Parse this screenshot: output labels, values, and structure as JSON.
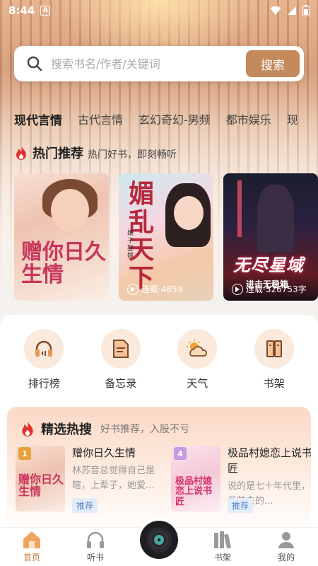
{
  "status_bar": {
    "time": "8:44",
    "notif_letter": "A"
  },
  "search": {
    "placeholder": "搜索书名/作者/关键词",
    "button_label": "搜索"
  },
  "categories": [
    "现代言情",
    "古代言情",
    "玄幻奇幻-男频",
    "都市娱乐",
    "现"
  ],
  "hot": {
    "title": "热门推荐",
    "subtitle": "热门好书，即刻畅听",
    "books": [
      {
        "cover_title": "赠你日久生情",
        "badge": ""
      },
      {
        "cover_title": "媚乱天下",
        "cover_sub": "娘子娶嫁",
        "badge": "连载·4859"
      },
      {
        "cover_title": "无尽星域",
        "cover_sub": "进击无稳箱",
        "badge": "连载·526753字"
      }
    ]
  },
  "shortcuts": [
    {
      "label": "排行榜",
      "icon": "headphones-icon"
    },
    {
      "label": "备忘录",
      "icon": "memo-icon"
    },
    {
      "label": "天气",
      "icon": "weather-icon"
    },
    {
      "label": "书架",
      "icon": "bookshelf-icon"
    }
  ],
  "featured": {
    "title": "精选热搜",
    "subtitle": "好书推荐，入股不亏",
    "items": [
      {
        "rank": "1",
        "name": "赠你日久生情",
        "desc": "林苏音总觉得自己是瞎，上辈子，她爱...",
        "tag": "推荐",
        "cover_title": "赠你日久生情"
      },
      {
        "rank": "4",
        "name": "极品村媳恋上说书匠",
        "desc": "说的是七十年代里，带着前夫的...",
        "tag": "推荐",
        "cover_title": "极品村媳恋上说书匠"
      }
    ]
  },
  "nav": [
    {
      "label": "首页",
      "icon": "home-icon",
      "active": true
    },
    {
      "label": "听书",
      "icon": "headphones-icon"
    },
    {
      "label": "",
      "icon": "record-disc-icon"
    },
    {
      "label": "书架",
      "icon": "books-icon"
    },
    {
      "label": "我的",
      "icon": "user-icon"
    }
  ],
  "colors": {
    "accent": "#c48a5b",
    "active_nav": "#c47a3f",
    "tag_blue": "#5b84c4"
  }
}
